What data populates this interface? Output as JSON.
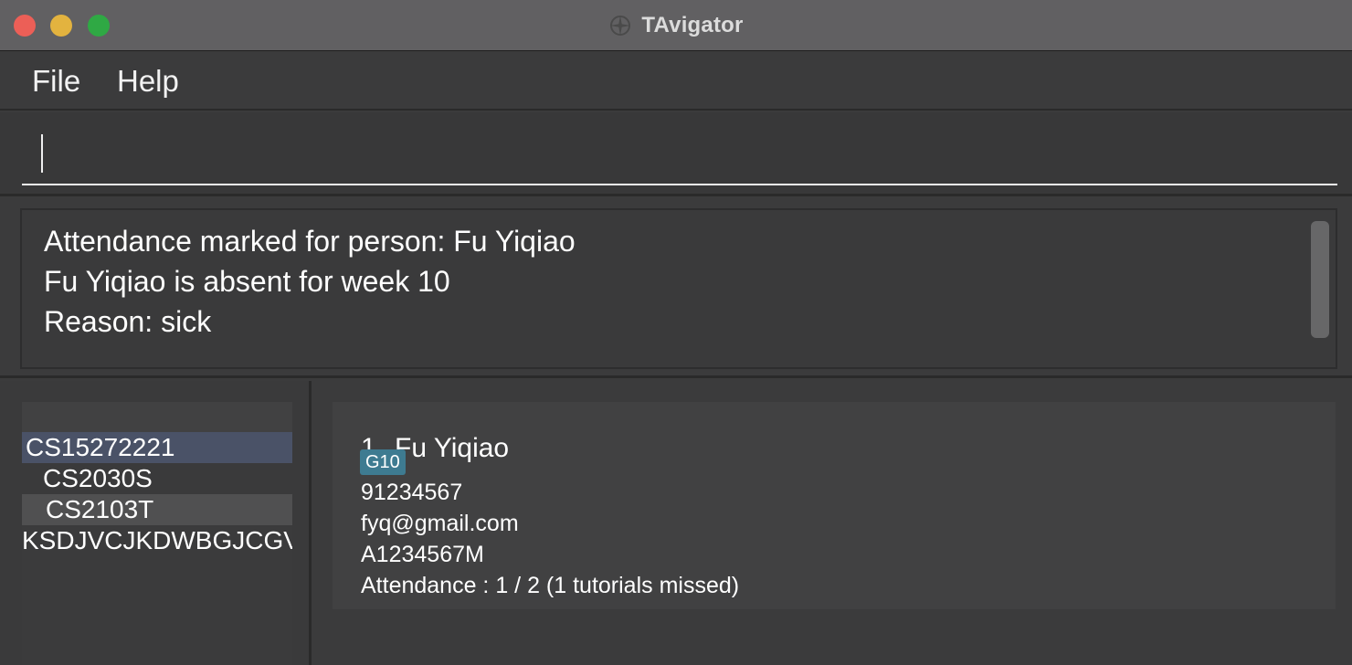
{
  "window": {
    "title": "TAvigator",
    "icon": "compass-icon"
  },
  "menu": {
    "file_label": "File",
    "help_label": "Help"
  },
  "command": {
    "value": "",
    "placeholder": ""
  },
  "result": {
    "lines": [
      "Attendance marked for person: Fu Yiqiao",
      "Fu Yiqiao is absent for week 10",
      "Reason: sick"
    ]
  },
  "class_list": {
    "items": [
      {
        "label": "CS15272221",
        "state": "selected"
      },
      {
        "label": "CS2030S",
        "state": "normal"
      },
      {
        "label": "CS2103T",
        "state": "hover"
      },
      {
        "label": "KSDJVCJKDWBGJCGV",
        "state": "normal"
      }
    ]
  },
  "person": {
    "index": "1.",
    "name": "Fu Yiqiao",
    "tag": "G10",
    "phone": "91234567",
    "email": "fyq@gmail.com",
    "student_id": "A1234567M",
    "attendance": "Attendance : 1 / 2 (1 tutorials missed)"
  },
  "colors": {
    "selected_row": "#4a5267",
    "tag": "#3e7b91",
    "close": "#ec5f57",
    "minimize": "#e3b33f",
    "maximize": "#2fa944"
  }
}
